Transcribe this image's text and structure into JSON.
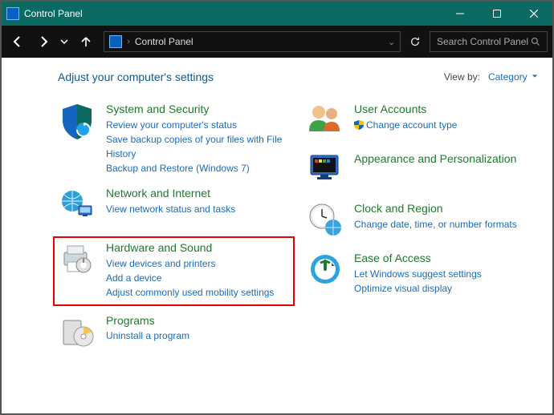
{
  "titlebar": {
    "title": "Control Panel"
  },
  "navbar": {
    "breadcrumb": "Control Panel",
    "search_placeholder": "Search Control Panel"
  },
  "header": {
    "heading": "Adjust your computer's settings",
    "viewby_label": "View by:",
    "viewby_value": "Category"
  },
  "left": {
    "system": {
      "title": "System and Security",
      "links": [
        "Review your computer's status",
        "Save backup copies of your files with File History",
        "Backup and Restore (Windows 7)"
      ]
    },
    "network": {
      "title": "Network and Internet",
      "links": [
        "View network status and tasks"
      ]
    },
    "hardware": {
      "title": "Hardware and Sound",
      "links": [
        "View devices and printers",
        "Add a device",
        "Adjust commonly used mobility settings"
      ]
    },
    "programs": {
      "title": "Programs",
      "links": [
        "Uninstall a program"
      ]
    }
  },
  "right": {
    "users": {
      "title": "User Accounts",
      "links": [
        "Change account type"
      ]
    },
    "appearance": {
      "title": "Appearance and Personalization"
    },
    "clock": {
      "title": "Clock and Region",
      "links": [
        "Change date, time, or number formats"
      ]
    },
    "ease": {
      "title": "Ease of Access",
      "links": [
        "Let Windows suggest settings",
        "Optimize visual display"
      ]
    }
  }
}
